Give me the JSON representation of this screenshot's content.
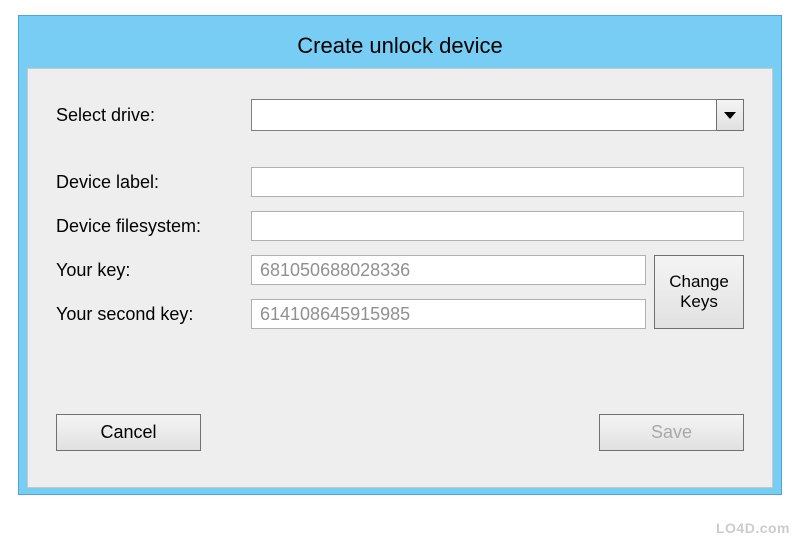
{
  "window": {
    "title": "Create unlock device"
  },
  "form": {
    "select_drive_label": "Select drive:",
    "select_drive_value": "",
    "device_label_label": "Device label:",
    "device_label_value": "",
    "device_filesystem_label": "Device filesystem:",
    "device_filesystem_value": "",
    "your_key_label": "Your key:",
    "your_key_value": "681050688028336",
    "your_second_key_label": "Your second key:",
    "your_second_key_value": "614108645915985"
  },
  "buttons": {
    "change_keys": "Change Keys",
    "cancel": "Cancel",
    "save": "Save"
  },
  "watermark": "LO4D.com"
}
